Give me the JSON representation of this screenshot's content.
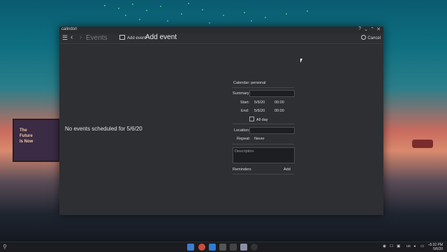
{
  "window": {
    "app_name": "calindori",
    "controls": {
      "help": "?",
      "minimize": "⌄",
      "maximize": "⌃",
      "close": "✕"
    }
  },
  "toolbar": {
    "menu_icon": "hamburger-menu-icon",
    "back_icon": "chevron-left-icon",
    "forward_icon": "chevron-right-icon",
    "events_label": "Events",
    "add_event_label": "Add event",
    "page_title": "Add event",
    "cancel_label": "Cancel"
  },
  "events_view": {
    "empty_message": "No events scheduled for 5/6/20"
  },
  "form": {
    "calendar": "Calendar: personal",
    "summary_label": "Summary:",
    "summary_value": "",
    "start_label": "Start:",
    "start_date": "5/6/20",
    "start_time": "00:00",
    "end_label": "End:",
    "end_date": "5/6/20",
    "end_time": "00:00",
    "all_day_label": "All day",
    "all_day_checked": false,
    "location_label": "Location:",
    "location_value": "",
    "repeat_label": "Repeat:",
    "repeat_value": "Never",
    "description_placeholder": "Description",
    "reminders_label": "Reminders",
    "add_reminder_label": "Add"
  },
  "wallpaper": {
    "billboard_lines": [
      "The",
      "Future",
      "Is Now"
    ]
  },
  "taskbar": {
    "keyboard_layout": "us",
    "time": "5:32 PM",
    "date": "5/6/20"
  },
  "colors": {
    "window_bg": "#2e2f33",
    "field_bg": "#1d1e21",
    "text": "#e6e6e6"
  }
}
